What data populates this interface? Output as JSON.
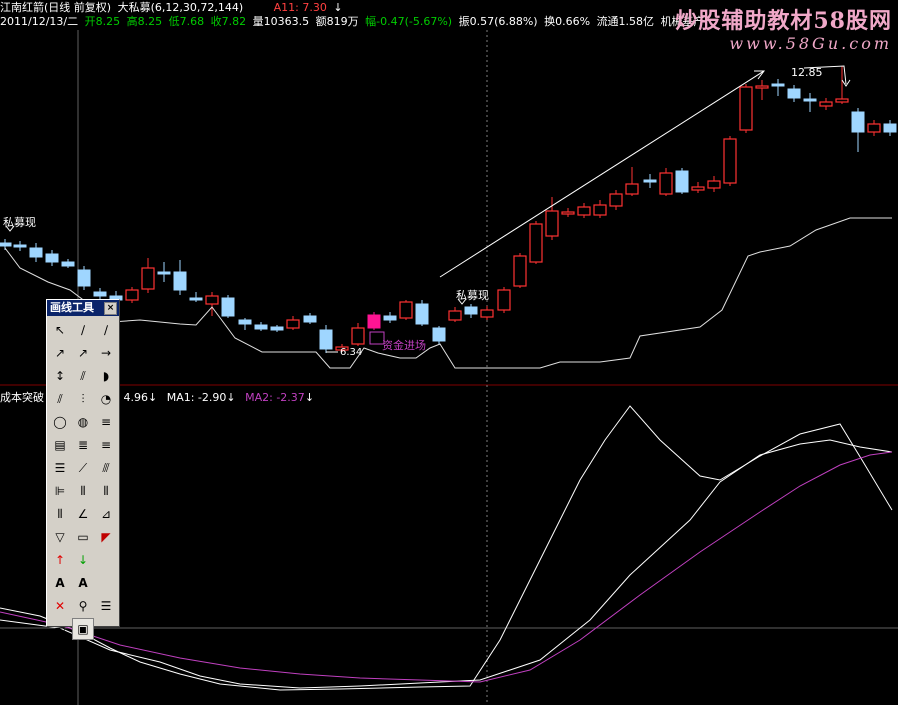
{
  "header": {
    "stock_name": "江南红箭(日线 前复权)",
    "indicator": "大私募(6,12,30,72,144)",
    "a11": "A11: 7.30",
    "date": "2011/12/13/二",
    "open": "开8.25",
    "high": "高8.25",
    "low": "低7.68",
    "close": "收7.82",
    "volume": "量10363.5",
    "amount": "额819万",
    "change": "幅-0.47(-5.67%)",
    "amplitude": "振0.57(6.88%)",
    "turnover": "换0.66%",
    "float_cap": "流通1.58亿",
    "sector": "机械基产"
  },
  "watermark": {
    "line1": "炒股辅助教材58股网",
    "line2": "www.58Gu.com"
  },
  "annotations": {
    "sm1": "私募现",
    "sm2": "私募现",
    "low_price": "6.34",
    "high_price": "12.85",
    "fund_in": "资金进场"
  },
  "indicator2": {
    "name": "成本突破",
    "v0": "4.96",
    "ma1": "MA1: -2.90",
    "ma2": "MA2: -2.37"
  },
  "toolbox": {
    "title": "画线工具",
    "close": "×",
    "tools": [
      {
        "name": "pointer-tool-icon",
        "glyph": "↖"
      },
      {
        "name": "line-segment-tool-icon",
        "glyph": "∕"
      },
      {
        "name": "straight-line-tool-icon",
        "glyph": "∕"
      },
      {
        "name": "arrow-line-tool-icon",
        "glyph": "↗"
      },
      {
        "name": "ray-tool-icon",
        "glyph": "↗"
      },
      {
        "name": "horizontal-ray-tool-icon",
        "glyph": "→"
      },
      {
        "name": "price-marker-tool-icon",
        "glyph": "↕"
      },
      {
        "name": "parallel-tool-icon",
        "glyph": "⫽"
      },
      {
        "name": "arc-tool-icon",
        "glyph": "◗"
      },
      {
        "name": "channel-tool-icon",
        "glyph": "⫽"
      },
      {
        "name": "speed-line-tool-icon",
        "glyph": "⫶"
      },
      {
        "name": "cycle-tool-icon",
        "glyph": "◔"
      },
      {
        "name": "circle-tool-icon",
        "glyph": "◯"
      },
      {
        "name": "spiral-tool-icon",
        "glyph": "◍"
      },
      {
        "name": "fibonacci-tool-icon",
        "glyph": "≡"
      },
      {
        "name": "gann-tool-icon",
        "glyph": "▤"
      },
      {
        "name": "golden-ratio-tool-icon",
        "glyph": "≣"
      },
      {
        "name": "percent-line-tool-icon",
        "glyph": "≡"
      },
      {
        "name": "band-tool-icon",
        "glyph": "☰"
      },
      {
        "name": "fan-tool-icon",
        "glyph": "⟋"
      },
      {
        "name": "gann-fan-tool-icon",
        "glyph": "⫻"
      },
      {
        "name": "parallel-channel-tool-icon",
        "glyph": "⊫"
      },
      {
        "name": "vertical-lines-tool-icon",
        "glyph": "⦀"
      },
      {
        "name": "time-zone-tool-icon",
        "glyph": "⦀"
      },
      {
        "name": "cycle-lines-tool-icon",
        "glyph": "⦀"
      },
      {
        "name": "angle-tool-icon",
        "glyph": "∠"
      },
      {
        "name": "speed-fan-tool-icon",
        "glyph": "⊿"
      },
      {
        "name": "triangle-tool-icon",
        "glyph": "▽"
      },
      {
        "name": "rectangle-tool-icon",
        "glyph": "▭"
      },
      {
        "name": "delete-line-tool-icon",
        "glyph": "◤"
      },
      {
        "name": "up-arrow-tool-icon",
        "glyph": "↑"
      },
      {
        "name": "down-arrow-tool-icon",
        "glyph": "↓"
      },
      {
        "name": "blank-tool-icon",
        "glyph": ""
      },
      {
        "name": "text-tool-icon",
        "glyph": "A"
      },
      {
        "name": "text-box-tool-icon",
        "glyph": "A"
      },
      {
        "name": "blank2-tool-icon",
        "glyph": ""
      },
      {
        "name": "delete-tool-icon",
        "glyph": "✕"
      },
      {
        "name": "search-tool-icon",
        "glyph": "⚲"
      },
      {
        "name": "list-tool-icon",
        "glyph": "☰"
      },
      {
        "name": "ruler-tool-icon",
        "glyph": "▭"
      },
      {
        "name": "note-tool-icon",
        "glyph": "▣"
      }
    ]
  },
  "colors": {
    "up": "#ff3333",
    "down": "#9fd6ff",
    "highlight": "#ff1493",
    "purple": "#c040c0",
    "red_line": "#800000",
    "green": "#00cc00"
  }
}
